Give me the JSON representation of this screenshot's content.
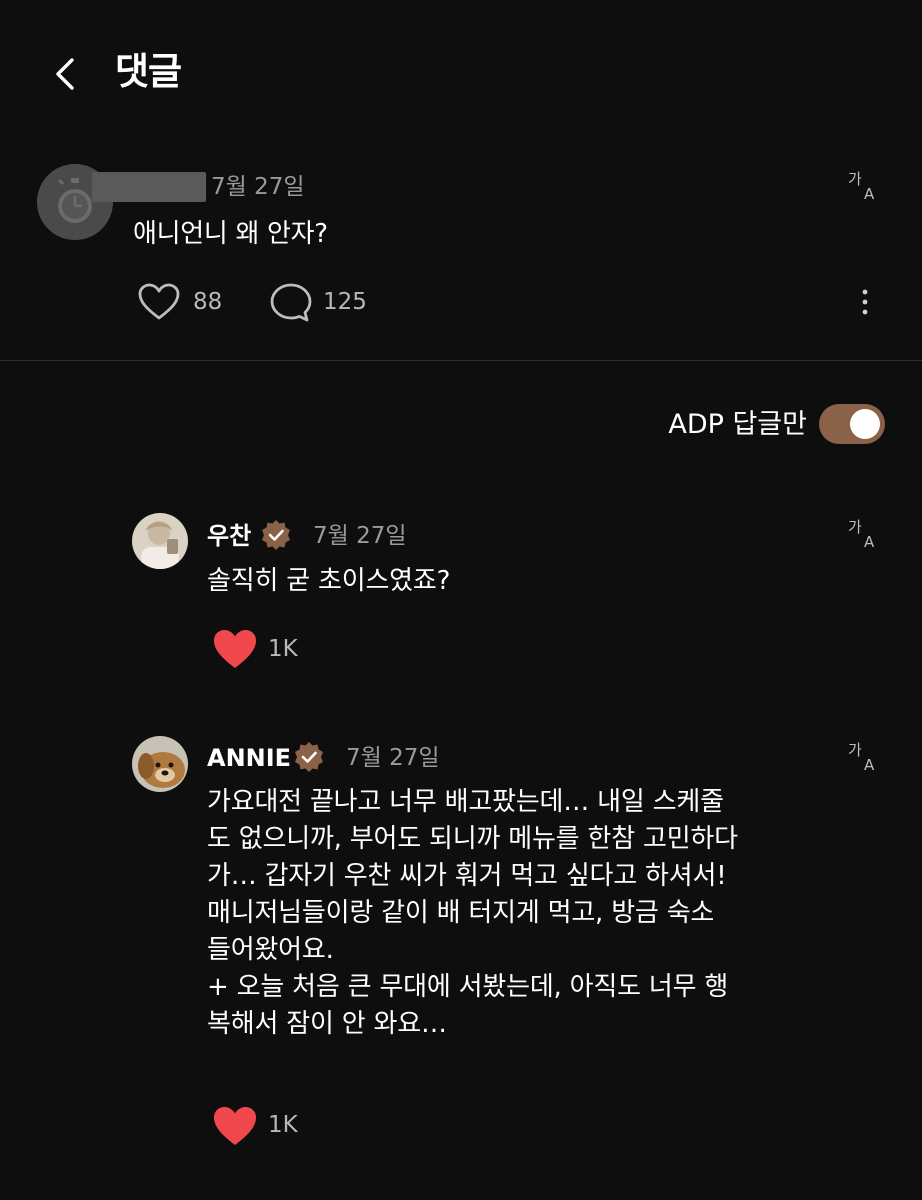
{
  "header": {
    "title": "댓글",
    "back_icon": "chevron-left-icon"
  },
  "original_comment": {
    "date": "7월 27일",
    "text": "애니언니 왜 안자?",
    "likes": "88",
    "replies": "125"
  },
  "filter": {
    "label": "ADP 답글만",
    "enabled": true
  },
  "replies": [
    {
      "name": "우찬",
      "date": "7월 27일",
      "lines": [
        "솔직히 굳 초이스였죠?"
      ],
      "likes": "1K"
    },
    {
      "name": "ANNIE",
      "date": "7월 27일",
      "lines": [
        "가요대전 끝나고 너무 배고팠는데… 내일 스케줄",
        "도 없으니까, 부어도 되니까 메뉴를 한참 고민하다",
        "가… 갑자기 우찬 씨가 훠거 먹고 싶다고 하셔서!",
        "매니저님들이랑 같이 배 터지게 먹고, 방금 숙소",
        "들어왔어요.",
        "+ 오늘 처음 큰 무대에 서봤는데, 아직도 너무 행",
        "복해서 잠이 안 와요…"
      ],
      "likes": "1K"
    }
  ],
  "colors": {
    "background": "#0f0e0e",
    "accent": "#8a6248",
    "heart": "#f0484c",
    "muted": "#9a9a9a"
  }
}
